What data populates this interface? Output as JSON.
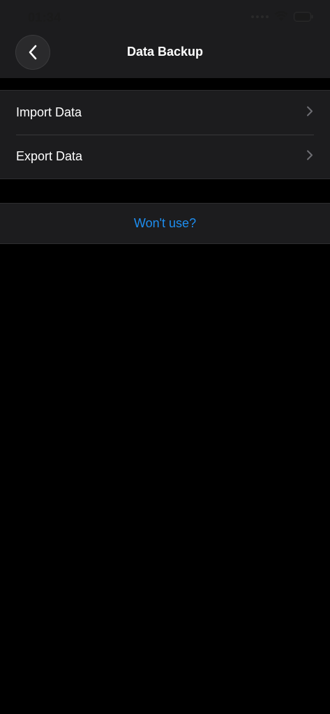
{
  "status_bar": {
    "time": "01:34"
  },
  "nav": {
    "title": "Data Backup",
    "back_icon": "chevron-left-icon"
  },
  "backup_options": [
    {
      "label": "Import Data",
      "icon": "chevron-right-icon"
    },
    {
      "label": "Export Data",
      "icon": "chevron-right-icon"
    }
  ],
  "secondary_action": {
    "label": "Won't use?"
  },
  "colors": {
    "background": "#000000",
    "surface": "#1c1c1e",
    "link": "#1e8ef0",
    "chevron": "#6e6e73"
  }
}
